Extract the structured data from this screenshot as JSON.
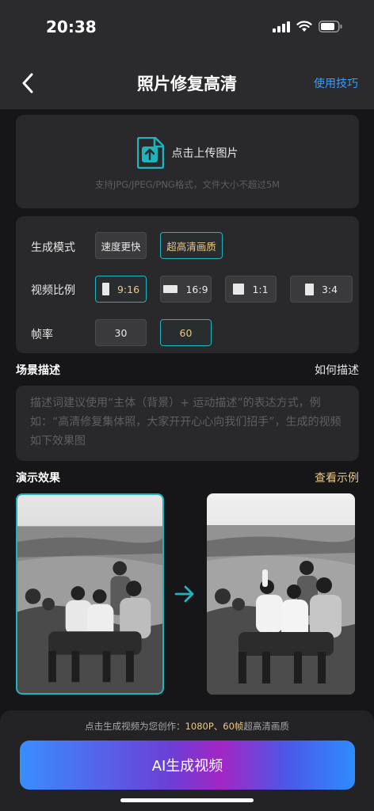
{
  "status": {
    "time": "20:38"
  },
  "nav": {
    "title": "照片修复高清",
    "tip_link": "使用技巧"
  },
  "upload": {
    "label": "点击上传图片",
    "hint": "支持JPG/JPEG/PNG格式，文件大小不超过5M"
  },
  "settings": {
    "mode": {
      "label": "生成模式",
      "options": [
        "速度更快",
        "超高清画质"
      ],
      "selected": "超高清画质"
    },
    "ratio": {
      "label": "视频比例",
      "options": [
        "9:16",
        "16:9",
        "1:1",
        "3:4"
      ],
      "selected": "9:16"
    },
    "fps": {
      "label": "帧率",
      "options": [
        "30",
        "60"
      ],
      "selected": "60"
    }
  },
  "scene": {
    "title": "场景描述",
    "link": "如何描述",
    "placeholder": "描述词建议使用“主体（背景）+ 运动描述”的表达方式，例如：“高清修复集体照，大家开开心心向我们招手”，生成的视频如下效果图"
  },
  "demo": {
    "title": "演示效果",
    "link": "查看示例"
  },
  "bottom": {
    "note_prefix": "点击生成视频为您创作：",
    "note_highlight": "1080P、60帧",
    "note_suffix": "超高清画质",
    "button": "AI生成视频"
  },
  "colors": {
    "accent_teal": "#1fb3bd",
    "gold": "#e9c889",
    "link_blue": "#3b9bff"
  },
  "icons": [
    "back-arrow-icon",
    "upload-image-icon",
    "arrow-right-icon",
    "signal-icon",
    "wifi-icon",
    "battery-icon"
  ]
}
